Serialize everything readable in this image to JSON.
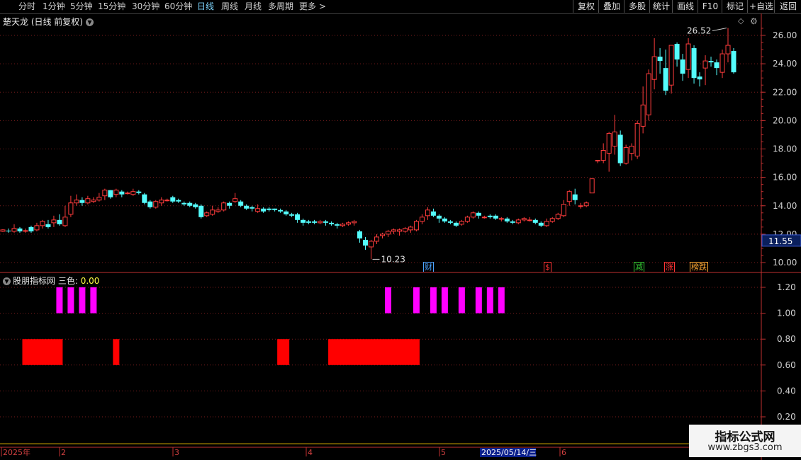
{
  "toolbar": {
    "periods": [
      "分时",
      "1分钟",
      "5分钟",
      "15分钟",
      "30分钟",
      "60分钟",
      "日线",
      "周线",
      "月线",
      "多周期",
      "更多 >"
    ],
    "active_period": "日线",
    "right_buttons": [
      "复权",
      "叠加",
      "多股",
      "统计",
      "画线",
      "F10",
      "标记",
      "+自选",
      "返回"
    ]
  },
  "chart": {
    "title": "楚天龙 (日线 前复权)",
    "high_label": "26.52",
    "low_label": "10.23",
    "current_price": "11.55",
    "y_ticks": [
      "26.00",
      "24.00",
      "22.00",
      "20.00",
      "18.00",
      "16.00",
      "14.00",
      "12.00",
      "10.00"
    ],
    "event_marks": [
      {
        "text": "财",
        "color": "#4aa3ff"
      },
      {
        "text": "$",
        "color": "#ff3333"
      },
      {
        "text": "减",
        "color": "#33cc33"
      },
      {
        "text": "涨",
        "color": "#ff3333"
      },
      {
        "text": "榜跌",
        "color": "#ffaa33"
      }
    ]
  },
  "indicator": {
    "name": "股朋指标网",
    "series_label": "三色:",
    "series_value": "0.00",
    "y_ticks": [
      "1.20",
      "1.00",
      "0.80",
      "0.60",
      "0.40",
      "0.20"
    ]
  },
  "xaxis": {
    "labels": [
      "2025年",
      "2",
      "3",
      "4",
      "5",
      "6"
    ],
    "cursor_date": "2025/05/14/三"
  },
  "watermark": {
    "line1": "指标公式网",
    "line2": "www.zbgs3.com"
  },
  "chart_data": {
    "type": "candlestick",
    "title": "楚天龙 (日线 前复权)",
    "ylim": [
      10,
      26.6
    ],
    "candles": [
      [
        12.2,
        12.3,
        12.15,
        12.35
      ],
      [
        12.25,
        12.2,
        12.1,
        12.4
      ],
      [
        12.2,
        12.4,
        12.1,
        12.7
      ],
      [
        12.4,
        12.2,
        12.1,
        12.5
      ],
      [
        12.2,
        12.25,
        12.1,
        12.4
      ],
      [
        12.5,
        12.2,
        12.1,
        12.6
      ],
      [
        12.3,
        12.6,
        12.2,
        12.8
      ],
      [
        12.6,
        12.9,
        12.4,
        13.0
      ],
      [
        12.7,
        12.5,
        12.4,
        13.0
      ],
      [
        12.8,
        13.0,
        12.5,
        13.3
      ],
      [
        13.0,
        12.7,
        12.6,
        13.4
      ],
      [
        12.6,
        13.2,
        12.5,
        14.0
      ],
      [
        13.4,
        14.2,
        13.2,
        14.7
      ],
      [
        14.2,
        14.4,
        14.0,
        14.8
      ],
      [
        14.4,
        14.2,
        14.0,
        14.6
      ],
      [
        14.2,
        14.5,
        14.1,
        14.7
      ],
      [
        14.3,
        14.4,
        14.2,
        14.6
      ],
      [
        14.4,
        14.6,
        14.3,
        14.9
      ],
      [
        14.7,
        15.1,
        14.4,
        15.2
      ],
      [
        15.1,
        14.6,
        14.5,
        15.1
      ],
      [
        14.8,
        15.1,
        14.6,
        15.2
      ],
      [
        15.0,
        14.8,
        14.6,
        15.1
      ],
      [
        14.9,
        14.9,
        14.8,
        15.0
      ],
      [
        14.8,
        15.0,
        14.7,
        15.2
      ],
      [
        15.0,
        14.9,
        14.8,
        15.1
      ],
      [
        14.8,
        14.2,
        14.1,
        14.9
      ],
      [
        14.3,
        13.9,
        13.8,
        14.4
      ],
      [
        13.9,
        14.3,
        13.8,
        14.4
      ],
      [
        14.2,
        14.4,
        14.0,
        14.6
      ],
      [
        14.4,
        14.4,
        14.3,
        14.5
      ],
      [
        14.6,
        14.3,
        14.2,
        14.7
      ],
      [
        14.4,
        14.3,
        14.2,
        14.5
      ],
      [
        14.2,
        14.1,
        14.0,
        14.3
      ],
      [
        14.2,
        14.0,
        13.9,
        14.3
      ],
      [
        14.1,
        13.9,
        13.8,
        14.2
      ],
      [
        14.0,
        13.2,
        13.1,
        14.1
      ],
      [
        13.3,
        13.5,
        13.2,
        13.6
      ],
      [
        13.4,
        13.7,
        13.3,
        14.0
      ],
      [
        13.6,
        13.7,
        13.5,
        13.9
      ],
      [
        13.7,
        14.2,
        13.6,
        14.3
      ],
      [
        14.2,
        14.0,
        13.8,
        14.3
      ],
      [
        14.3,
        14.5,
        14.2,
        14.9
      ],
      [
        14.3,
        14.0,
        13.9,
        14.4
      ],
      [
        14.0,
        13.8,
        13.7,
        14.1
      ],
      [
        13.9,
        13.8,
        13.6,
        14.0
      ],
      [
        13.6,
        13.8,
        13.5,
        14.1
      ],
      [
        13.8,
        13.6,
        13.5,
        13.9
      ],
      [
        13.8,
        13.7,
        13.6,
        13.9
      ],
      [
        13.8,
        13.7,
        13.6,
        13.8
      ],
      [
        13.7,
        13.6,
        13.5,
        13.8
      ],
      [
        13.6,
        13.4,
        13.3,
        13.7
      ],
      [
        13.4,
        13.3,
        13.2,
        13.5
      ],
      [
        13.4,
        13.0,
        12.8,
        13.5
      ],
      [
        13.0,
        12.8,
        12.6,
        13.1
      ],
      [
        12.9,
        12.8,
        12.7,
        13.0
      ],
      [
        12.9,
        12.8,
        12.7,
        13.0
      ],
      [
        12.8,
        12.9,
        12.7,
        13.0
      ],
      [
        12.9,
        12.8,
        12.6,
        13.0
      ],
      [
        12.8,
        12.7,
        12.6,
        12.9
      ],
      [
        12.7,
        12.6,
        12.4,
        12.8
      ],
      [
        12.6,
        12.7,
        12.5,
        12.8
      ],
      [
        12.7,
        12.8,
        12.6,
        12.9
      ],
      [
        12.8,
        12.9,
        12.6,
        13.0
      ],
      [
        12.2,
        11.7,
        11.4,
        12.3
      ],
      [
        11.6,
        11.2,
        10.9,
        11.8
      ],
      [
        11.1,
        11.5,
        10.23,
        11.6
      ],
      [
        11.5,
        11.8,
        11.3,
        12.0
      ],
      [
        11.9,
        12.0,
        11.7,
        12.1
      ],
      [
        12.0,
        12.2,
        11.8,
        12.3
      ],
      [
        12.2,
        12.3,
        12.0,
        12.4
      ],
      [
        12.2,
        12.3,
        11.9,
        12.4
      ],
      [
        12.2,
        12.4,
        12.1,
        12.5
      ],
      [
        12.3,
        12.5,
        12.1,
        12.6
      ],
      [
        12.3,
        12.9,
        12.2,
        13.0
      ],
      [
        12.9,
        13.2,
        12.7,
        13.4
      ],
      [
        13.3,
        13.7,
        13.0,
        13.9
      ],
      [
        13.6,
        13.3,
        13.2,
        13.8
      ],
      [
        13.3,
        13.1,
        12.8,
        13.4
      ],
      [
        13.1,
        12.9,
        12.8,
        13.2
      ],
      [
        12.9,
        12.8,
        12.7,
        13.0
      ],
      [
        12.8,
        12.6,
        12.5,
        12.9
      ],
      [
        12.7,
        12.9,
        12.6,
        13.0
      ],
      [
        12.9,
        13.2,
        12.8,
        13.3
      ],
      [
        13.2,
        13.5,
        13.1,
        13.6
      ],
      [
        13.5,
        13.3,
        13.1,
        13.6
      ],
      [
        13.2,
        13.2,
        13.1,
        13.3
      ],
      [
        13.3,
        13.2,
        13.1,
        13.4
      ],
      [
        13.3,
        13.1,
        13.0,
        13.4
      ],
      [
        13.1,
        13.1,
        12.9,
        13.2
      ],
      [
        13.1,
        12.9,
        12.8,
        13.2
      ],
      [
        12.9,
        12.8,
        12.7,
        13.0
      ],
      [
        12.8,
        13.0,
        12.7,
        13.1
      ],
      [
        13.0,
        13.1,
        12.9,
        13.2
      ],
      [
        13.0,
        13.0,
        12.9,
        13.2
      ],
      [
        13.0,
        12.8,
        12.7,
        13.1
      ],
      [
        12.8,
        12.6,
        12.5,
        12.9
      ],
      [
        12.6,
        12.9,
        12.5,
        13.1
      ],
      [
        12.9,
        13.1,
        12.8,
        13.2
      ],
      [
        13.1,
        13.4,
        13.0,
        13.5
      ],
      [
        13.3,
        14.1,
        13.2,
        14.4
      ],
      [
        14.3,
        15.0,
        14.0,
        15.1
      ],
      [
        14.8,
        14.4,
        14.1,
        15.2
      ],
      [
        14.0,
        14.0,
        13.8,
        14.2
      ],
      [
        14.0,
        14.2,
        13.9,
        14.3
      ],
      [
        14.9,
        15.9,
        14.9,
        15.9
      ],
      [
        17.2,
        17.2,
        17.0,
        17.2
      ],
      [
        17.2,
        17.9,
        17.0,
        18.4
      ],
      [
        17.7,
        19.1,
        16.4,
        19.2
      ],
      [
        18.2,
        19.2,
        17.6,
        20.4
      ],
      [
        19.0,
        17.0,
        16.8,
        19.3
      ],
      [
        17.0,
        18.1,
        16.9,
        18.3
      ],
      [
        17.7,
        18.2,
        17.2,
        18.4
      ],
      [
        17.5,
        19.8,
        17.3,
        20.0
      ],
      [
        19.6,
        21.1,
        19.1,
        22.4
      ],
      [
        20.4,
        23.3,
        20.0,
        23.6
      ],
      [
        22.9,
        24.5,
        22.2,
        25.8
      ],
      [
        24.5,
        24.2,
        23.3,
        25.1
      ],
      [
        23.7,
        22.1,
        21.8,
        25.0
      ],
      [
        22.5,
        25.3,
        21.9,
        25.3
      ],
      [
        25.4,
        24.3,
        23.8,
        25.5
      ],
      [
        24.3,
        23.3,
        22.8,
        24.7
      ],
      [
        23.6,
        25.4,
        23.0,
        25.8
      ],
      [
        25.1,
        23.0,
        22.6,
        25.3
      ],
      [
        23.1,
        22.9,
        22.4,
        23.4
      ],
      [
        23.7,
        24.2,
        22.5,
        24.6
      ],
      [
        24.2,
        24.1,
        23.8,
        24.5
      ],
      [
        24.1,
        23.7,
        23.2,
        24.3
      ],
      [
        23.4,
        24.7,
        23.0,
        25.0
      ],
      [
        24.7,
        25.3,
        24.1,
        26.52
      ],
      [
        24.9,
        23.4,
        23.3,
        25.1
      ]
    ],
    "bar_order": "open,close,low,high"
  },
  "indicator_data": {
    "magenta_1": [
      10,
      12,
      14,
      16,
      68,
      73,
      76,
      78,
      81,
      84,
      86,
      88
    ],
    "red_0_8_ranges": [
      [
        4,
        10
      ],
      [
        20,
        20
      ],
      [
        49,
        50
      ],
      [
        58,
        73
      ]
    ]
  },
  "colors": {
    "up": "#ff3c3c",
    "down": "#54fcfc",
    "grid": "#7a1d1d",
    "magenta": "#ff00ff",
    "red": "#ff0000",
    "axis": "#c03030"
  }
}
